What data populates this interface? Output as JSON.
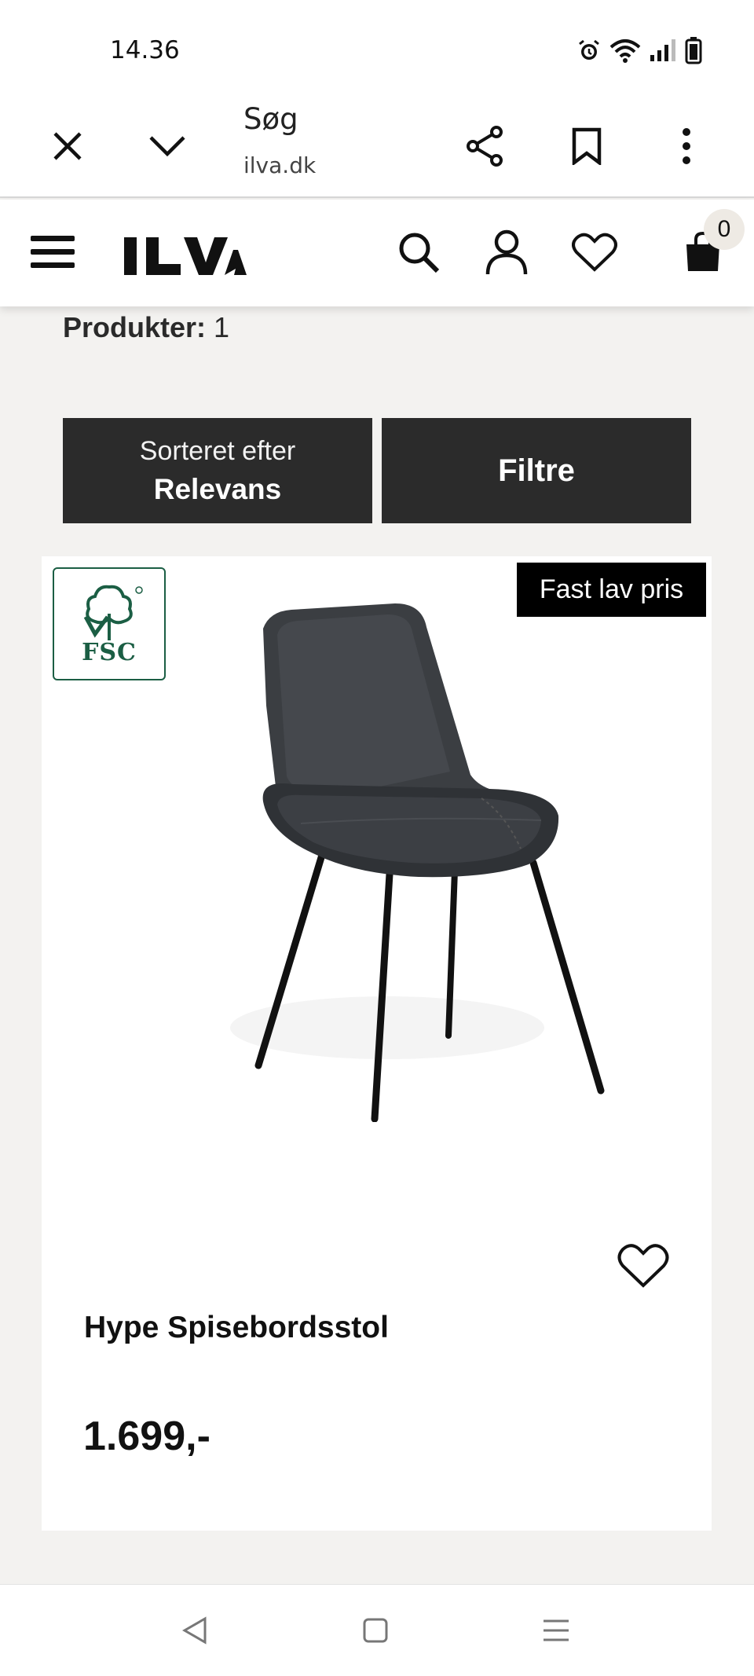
{
  "status_bar": {
    "time": "14.36"
  },
  "browser_bar": {
    "title": "Søg",
    "url": "ilva.dk"
  },
  "site_header": {
    "logo_text": "ILVA",
    "cart_count": "0"
  },
  "listing": {
    "count_label": "Produkter:",
    "count_value": "1",
    "sort_top": "Sorteret efter",
    "sort_value": "Relevans",
    "filter_label": "Filtre"
  },
  "product": {
    "badge": "Fast lav pris",
    "certification": "FSC",
    "name": "Hype Spisebordsstol",
    "price": "1.699,-"
  },
  "colors": {
    "accent": "#2b2b2b",
    "fsc_green": "#1b5e44",
    "page_bg": "#f3f2f0"
  }
}
